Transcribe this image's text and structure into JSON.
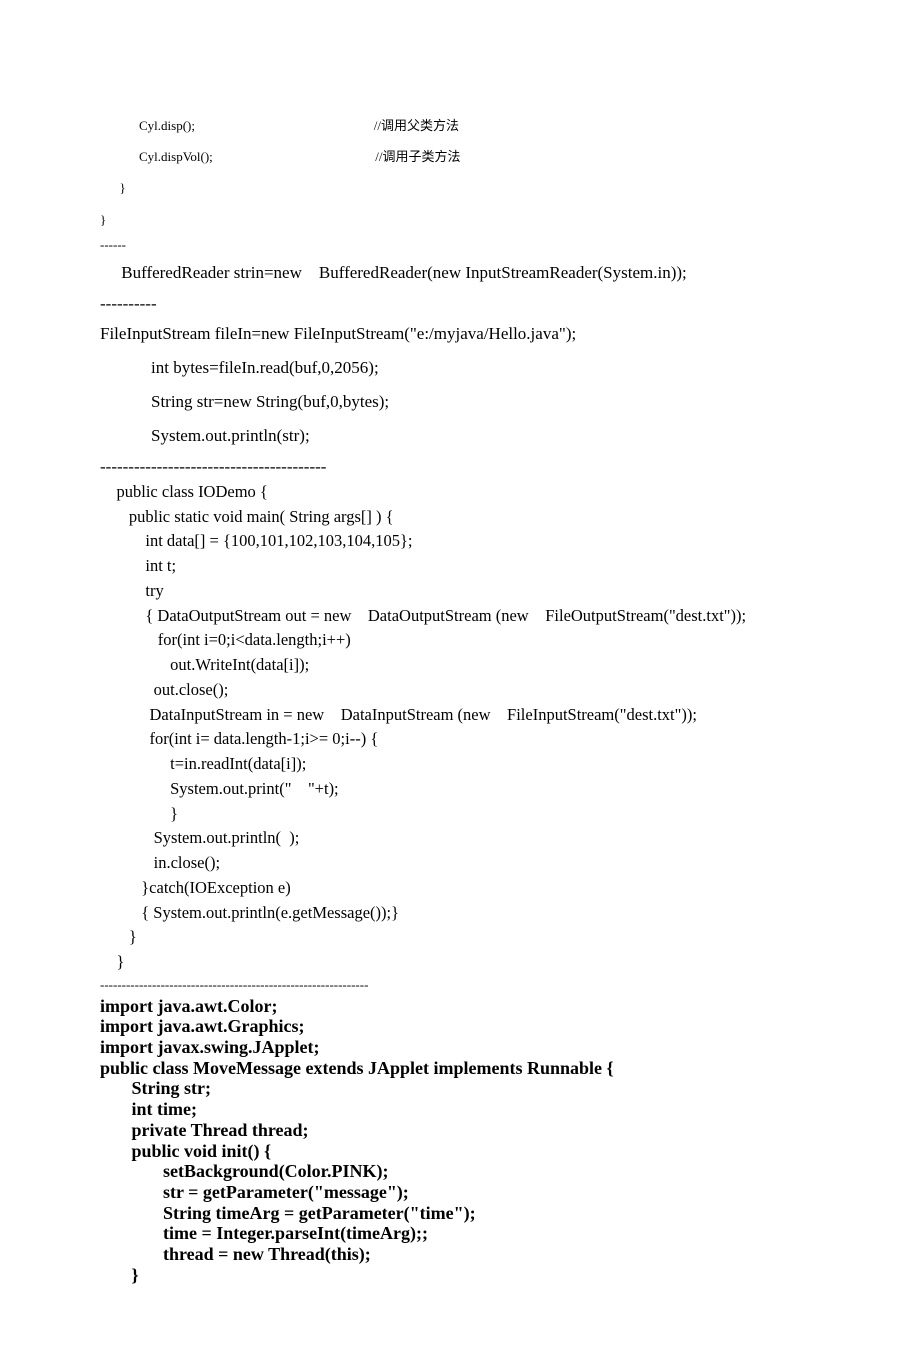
{
  "block1": {
    "l1": "            Cyl.disp();                                                       //调用父类方法",
    "l2": "            Cyl.dispVol();                                                  //调用子类方法",
    "l3": "      }",
    "l4": "}"
  },
  "sep1": "------",
  "line_buffered": "     BufferedReader strin=new    BufferedReader(new InputStreamReader(System.in));",
  "sep2": "----------",
  "block2": {
    "l1": "FileInputStream fileIn=new FileInputStream(\"e:/myjava/Hello.java\");",
    "l2": "            int bytes=fileIn.read(buf,0,2056);",
    "l3": "            String str=new String(buf,0,bytes);",
    "l4": "            System.out.println(str);"
  },
  "sep3": "----------------------------------------",
  "block3": {
    "l1": "    public class IODemo {",
    "l2": "       public static void main( String args[] ) {",
    "l3": "           int data[] = {100,101,102,103,104,105};",
    "l4": "           int t;",
    "l5": "           try",
    "l6": "           { DataOutputStream out = new    DataOutputStream (new    FileOutputStream(\"dest.txt\"));",
    "l7": "              for(int i=0;i<data.length;i++)",
    "l8": "                 out.WriteInt(data[i]);",
    "l9": "             out.close();",
    "l10": "            DataInputStream in = new    DataInputStream (new    FileInputStream(\"dest.txt\"));",
    "l11": "            for(int i= data.length-1;i>= 0;i--) {",
    "l12": "                 t=in.readInt(data[i]);",
    "l13": "                 System.out.print(\"    \"+t);",
    "l14": "                 }",
    "l15": "             System.out.println(  );",
    "l16": "             in.close();",
    "l17": "          }catch(IOException e)",
    "l18": "          { System.out.println(e.getMessage());}",
    "l19": "       }",
    "l20": "    }"
  },
  "sep4": "--------------------------------------------------------------",
  "block4": {
    "l1": "import java.awt.Color;",
    "l2": "import java.awt.Graphics;",
    "l3": "import javax.swing.JApplet;",
    "l4": "public class MoveMessage extends JApplet implements Runnable {",
    "l5": "       String str;",
    "l6": "       int time;",
    "l7": "       private Thread thread;",
    "l8": "       public void init() {",
    "l9": "              setBackground(Color.PINK);",
    "l10": "              str = getParameter(\"message\");",
    "l11": "              String timeArg = getParameter(\"time\");",
    "l12": "              time = Integer.parseInt(timeArg);;",
    "l13": "              thread = new Thread(this);",
    "l14": "       }"
  }
}
